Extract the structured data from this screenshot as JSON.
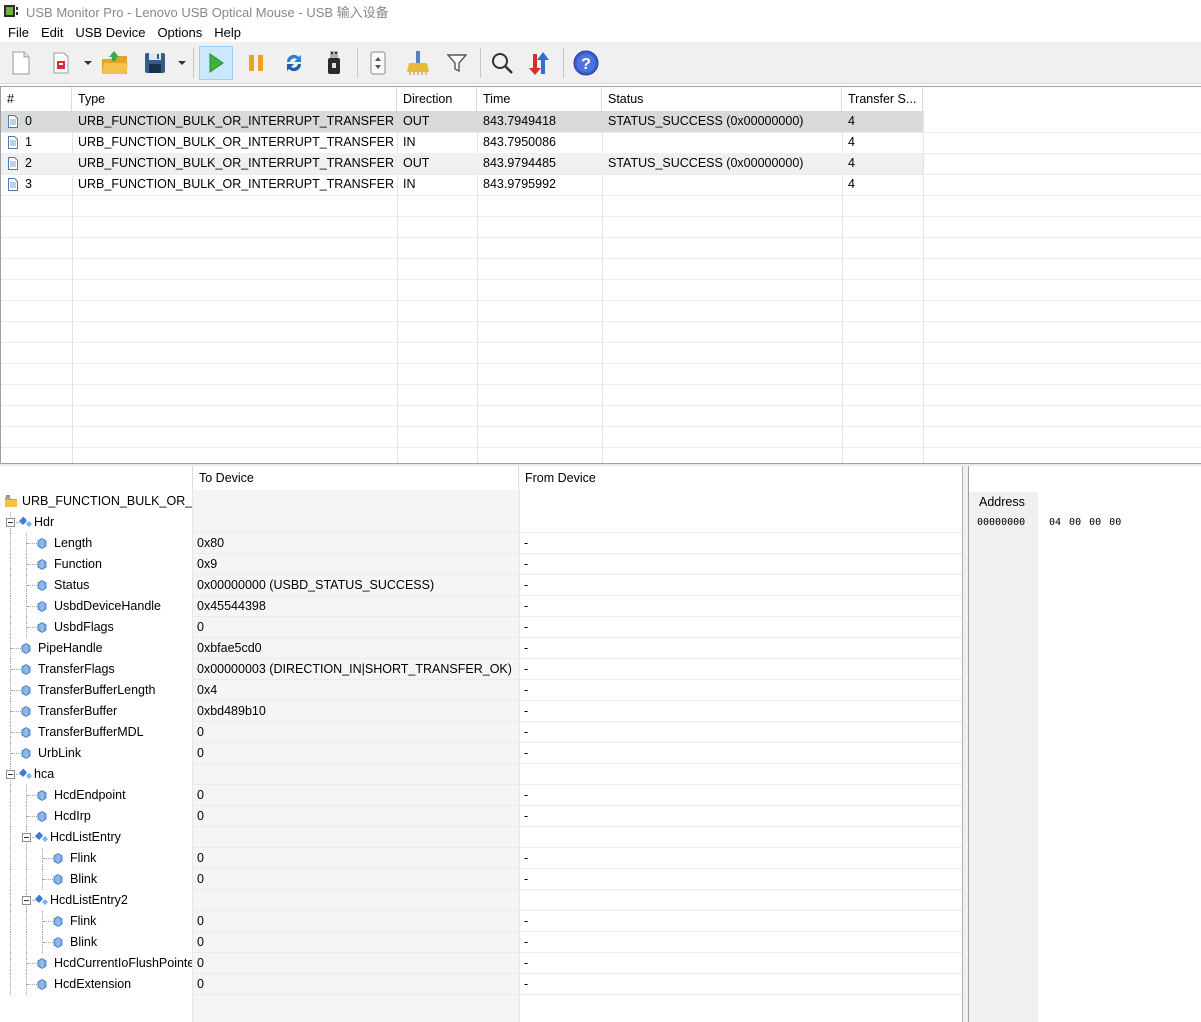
{
  "window": {
    "title": "USB Monitor Pro - Lenovo USB Optical Mouse - USB 输入设备"
  },
  "menu": [
    "File",
    "Edit",
    "USB Device",
    "Options",
    "Help"
  ],
  "toolbar": {
    "buttons": [
      "new-session-icon",
      "record-icon",
      "open-folder-icon",
      "save-disk-icon",
      "play-icon",
      "pause-icon",
      "refresh-icon",
      "usb-stick-icon",
      "session-props-icon",
      "clear-broom-icon",
      "filter-funnel-icon",
      "search-magnifier-icon",
      "sort-arrows-icon",
      "help-question-icon"
    ],
    "active": "play-icon"
  },
  "grid": {
    "columns": [
      "#",
      "Type",
      "Direction",
      "Time",
      "Status",
      "Transfer S..."
    ],
    "rows": [
      {
        "num": "0",
        "type": "URB_FUNCTION_BULK_OR_INTERRUPT_TRANSFER",
        "direction": "OUT",
        "time": "843.7949418",
        "status": "STATUS_SUCCESS (0x00000000)",
        "size": "4"
      },
      {
        "num": "1",
        "type": "URB_FUNCTION_BULK_OR_INTERRUPT_TRANSFER",
        "direction": "IN",
        "time": "843.7950086",
        "status": "",
        "size": "4"
      },
      {
        "num": "2",
        "type": "URB_FUNCTION_BULK_OR_INTERRUPT_TRANSFER",
        "direction": "OUT",
        "time": "843.9794485",
        "status": "STATUS_SUCCESS (0x00000000)",
        "size": "4"
      },
      {
        "num": "3",
        "type": "URB_FUNCTION_BULK_OR_INTERRUPT_TRANSFER",
        "direction": "IN",
        "time": "843.9795992",
        "status": "",
        "size": "4"
      }
    ]
  },
  "details": {
    "columns": [
      "To Device",
      "From Device"
    ],
    "root": "URB_FUNCTION_BULK_OR_INTERRUPT_TRANSFER",
    "rows": [
      {
        "name": "Hdr",
        "to": "",
        "from": ""
      },
      {
        "name": "Length",
        "to": "0x80",
        "from": "-"
      },
      {
        "name": "Function",
        "to": "0x9",
        "from": "-"
      },
      {
        "name": "Status",
        "to": "0x00000000 (USBD_STATUS_SUCCESS)",
        "from": "-"
      },
      {
        "name": "UsbdDeviceHandle",
        "to": "0x45544398",
        "from": "-"
      },
      {
        "name": "UsbdFlags",
        "to": "0",
        "from": "-"
      },
      {
        "name": "PipeHandle",
        "to": "0xbfae5cd0",
        "from": "-"
      },
      {
        "name": "TransferFlags",
        "to": "0x00000003 (DIRECTION_IN|SHORT_TRANSFER_OK)",
        "from": "-"
      },
      {
        "name": "TransferBufferLength",
        "to": "0x4",
        "from": "-"
      },
      {
        "name": "TransferBuffer",
        "to": "0xbd489b10",
        "from": "-"
      },
      {
        "name": "TransferBufferMDL",
        "to": "0",
        "from": "-"
      },
      {
        "name": "UrbLink",
        "to": "0",
        "from": "-"
      },
      {
        "name": "hca",
        "to": "",
        "from": ""
      },
      {
        "name": "HcdEndpoint",
        "to": "0",
        "from": "-"
      },
      {
        "name": "HcdIrp",
        "to": "0",
        "from": "-"
      },
      {
        "name": "HcdListEntry",
        "to": "",
        "from": ""
      },
      {
        "name": "Flink",
        "to": "0",
        "from": "-"
      },
      {
        "name": "Blink",
        "to": "0",
        "from": "-"
      },
      {
        "name": "HcdListEntry2",
        "to": "",
        "from": ""
      },
      {
        "name": "Flink",
        "to": "0",
        "from": "-"
      },
      {
        "name": "Blink",
        "to": "0",
        "from": "-"
      },
      {
        "name": "HcdCurrentIoFlushPointer",
        "to": "0",
        "from": "-"
      },
      {
        "name": "HcdExtension",
        "to": "0",
        "from": "-"
      }
    ]
  },
  "hex": {
    "header": "Address",
    "address": "00000000",
    "bytes": "04 00 00 00"
  }
}
